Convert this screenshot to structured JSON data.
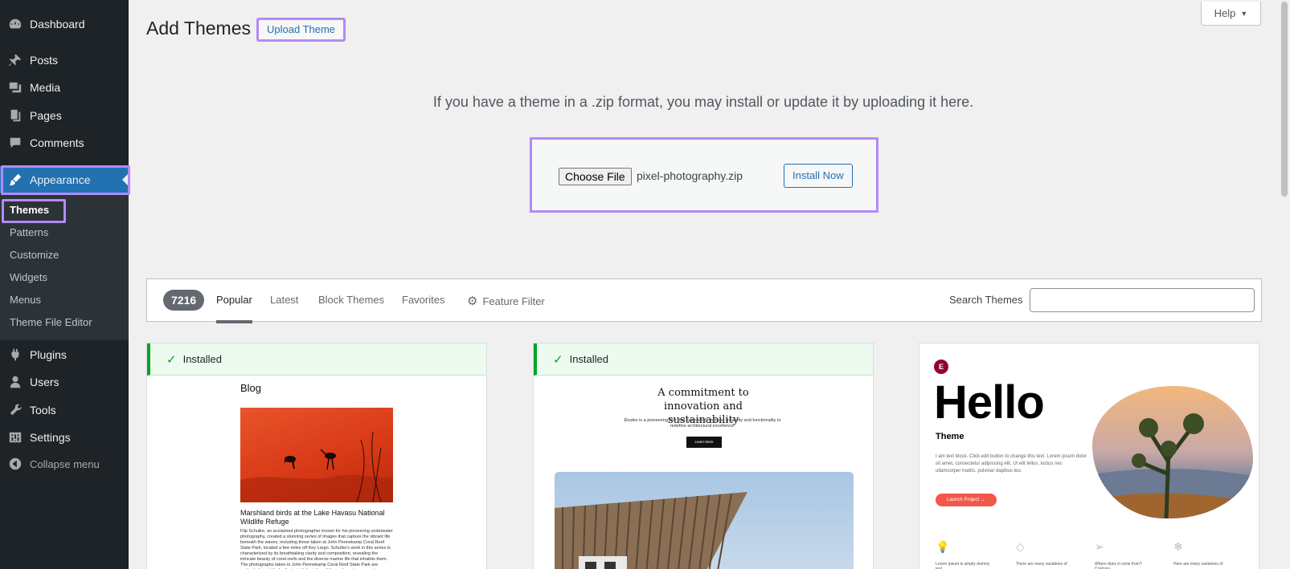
{
  "sidebar": {
    "items": [
      {
        "label": "Dashboard",
        "icon": "dashboard-icon"
      },
      {
        "label": "Posts",
        "icon": "pin-icon"
      },
      {
        "label": "Media",
        "icon": "media-icon"
      },
      {
        "label": "Pages",
        "icon": "pages-icon"
      },
      {
        "label": "Comments",
        "icon": "comment-icon"
      },
      {
        "label": "Appearance",
        "icon": "brush-icon"
      },
      {
        "label": "Plugins",
        "icon": "plug-icon"
      },
      {
        "label": "Users",
        "icon": "user-icon"
      },
      {
        "label": "Tools",
        "icon": "wrench-icon"
      },
      {
        "label": "Settings",
        "icon": "settings-icon"
      }
    ],
    "submenu": [
      "Themes",
      "Patterns",
      "Customize",
      "Widgets",
      "Menus",
      "Theme File Editor"
    ],
    "collapse_label": "Collapse menu"
  },
  "header": {
    "title": "Add Themes",
    "upload_label": "Upload Theme",
    "help_label": "Help"
  },
  "upload": {
    "description": "If you have a theme in a .zip format, you may install or update it by uploading it here.",
    "choose_label": "Choose File",
    "file_name": "pixel-photography.zip",
    "install_label": "Install Now"
  },
  "filter": {
    "count": "7216",
    "tabs": [
      "Popular",
      "Latest",
      "Block Themes",
      "Favorites"
    ],
    "feature_filter": "Feature Filter",
    "search_label": "Search Themes",
    "search_value": ""
  },
  "themes": {
    "installed_label": "Installed",
    "card1": {
      "blog": "Blog",
      "post_title": "Marshland birds at the Lake Havasu National Wildlife Refuge",
      "post_text": "Flip Schulke, an acclaimed photographer known for his pioneering underwater photography, created a stunning series of images that capture the vibrant life beneath the waves, including those taken at John Pennekamp Coral Reef State Park, located a few miles off Key Largo. Schulke's work in this series is characterized by its breathtaking clarity and composition, revealing the intricate beauty of coral reefs and the diverse marine life that inhabits them. The photographs taken in John Pennekamp Coral Reef State Park are particularly notable for their vivid depiction of the underwater ecosystem."
    },
    "card2": {
      "title": "A commitment to innovation and sustainability",
      "text": "Études is a pioneering firm that seamlessly merges creativity and functionality to redefine architectural excellence.",
      "button": "Learn More"
    },
    "card3": {
      "logo": "E",
      "hello": "Hello",
      "theme": "Theme",
      "text": "I am text block. Click edit button to change this text. Lorem ipsum dolor sit amet, consectetur adipiscing elit. Ut elit tellus, luctus nec ullamcorper mattis, pulvinar dapibus leo.",
      "button": "Launch Project →",
      "features": [
        "Lorem Ipsum is simply dummy text",
        "There are many variations of",
        "Where does it come from? Contrary",
        "Here are many variations of"
      ]
    }
  },
  "colors": {
    "sidebar_bg": "#1d2327",
    "accent": "#2271b1",
    "highlight": "#b38afa",
    "installed_green": "#00a32a"
  }
}
